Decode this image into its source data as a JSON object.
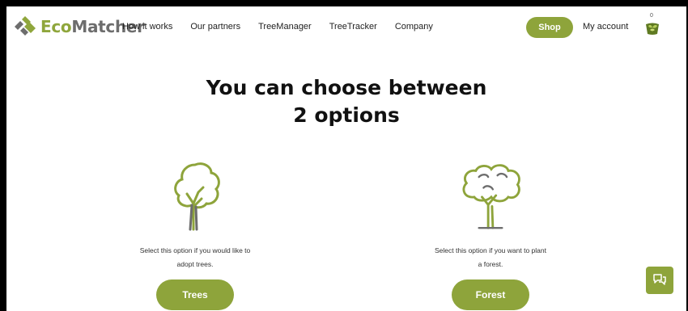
{
  "header": {
    "logo_text": "EcoMatcher",
    "nav": [
      "How it works",
      "Our partners",
      "TreeManager",
      "TreeTracker",
      "Company"
    ],
    "shop_label": "Shop",
    "account_label": "My account",
    "cart_count": "0"
  },
  "hero": {
    "title_line1": "You can choose between",
    "title_line2": "2 options"
  },
  "options": {
    "trees": {
      "desc_line1": "Select this option if you would like to",
      "desc_line2": "adopt trees.",
      "button": "Trees"
    },
    "forest": {
      "desc_line1": "Select this option if you want to plant",
      "desc_line2": "a forest.",
      "button": "Forest"
    }
  },
  "colors": {
    "brand_green": "#8ea43b",
    "logo_grey": "#6d6d6d"
  },
  "icons": [
    "logo-mark-icon",
    "tree-icon",
    "forest-icon",
    "cart-icon",
    "chat-icon"
  ]
}
